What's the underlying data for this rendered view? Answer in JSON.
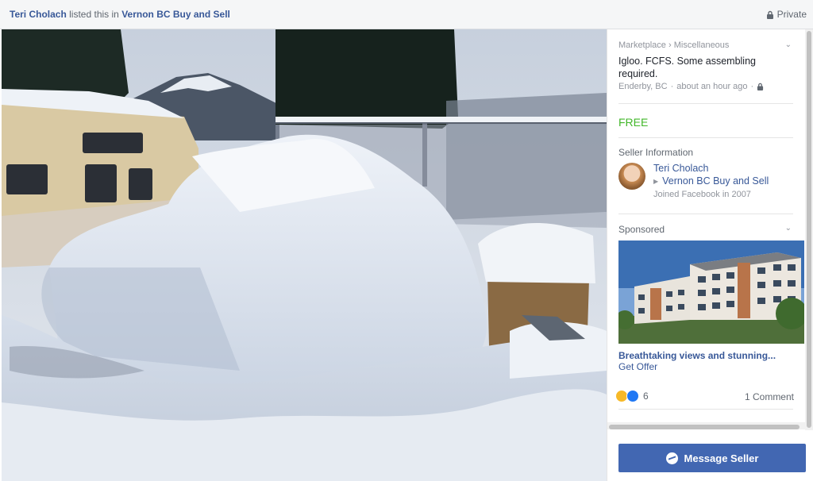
{
  "header": {
    "poster_name": "Teri Cholach",
    "listed_text": "listed this in",
    "group_name": "Vernon BC Buy and Sell",
    "privacy_label": "Private",
    "privacy_icon": "lock-icon"
  },
  "photo": {
    "alt_subject": "snow igloo photo"
  },
  "listing": {
    "breadcrumb_root": "Marketplace",
    "breadcrumb_sep": "›",
    "breadcrumb_leaf": "Miscellaneous",
    "title": "Igloo. FCFS. Some assembling required.",
    "location": "Enderby, BC",
    "time": "about an hour ago",
    "price": "FREE"
  },
  "seller": {
    "heading": "Seller Information",
    "name": "Teri Cholach",
    "group": "Vernon BC Buy and Sell",
    "joined": "Joined Facebook in 2007"
  },
  "ad": {
    "label": "Sponsored",
    "headline": "Breathtaking views and stunning...",
    "cta": "Get Offer",
    "reaction_count": "6",
    "comments": "1 Comment"
  },
  "actions": {
    "message_seller": "Message Seller"
  },
  "colors": {
    "link": "#385898",
    "price": "#42b72a",
    "button": "#4267b2"
  }
}
